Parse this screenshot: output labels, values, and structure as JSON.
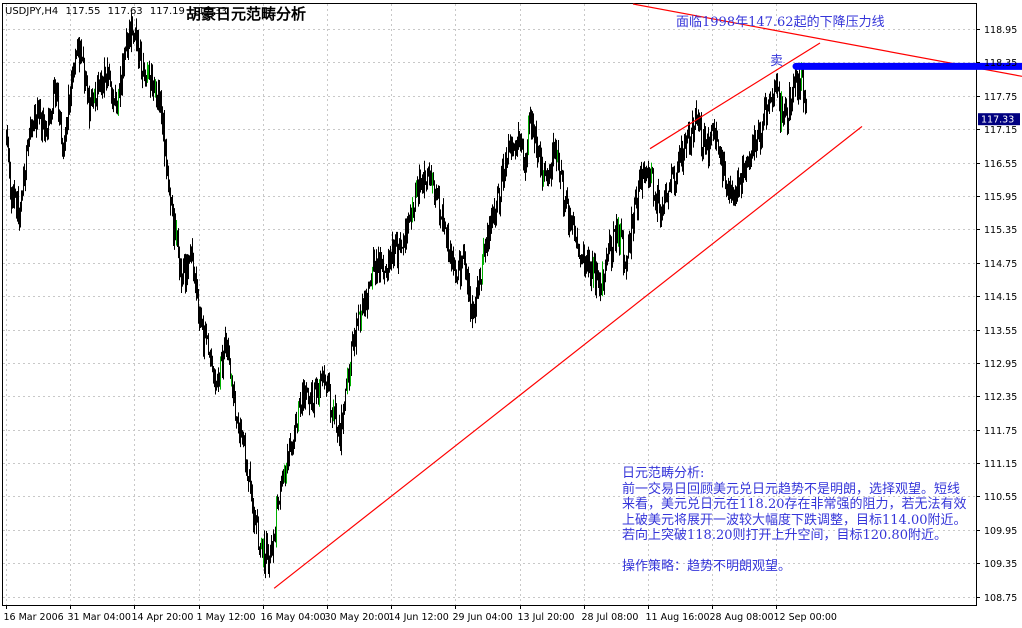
{
  "header": {
    "symbol": "USDJPY,H4",
    "open": "117.55",
    "high": "117.63",
    "low": "117.19",
    "close": "117.33",
    "title": "胡豪日元范畴分析"
  },
  "annotations": {
    "resistance_note": "面临1998年147.62起的下降压力线",
    "sell_note": "卖",
    "analysis_title": "日元范畴分析:",
    "analysis_body": "前一交易日回顾美元兑日元趋势不是明朗，选择观望。短线来看，美元兑日元在118.20存在非常强的阻力，若无法有效上破美元将展开一波较大幅度下跌调整，目标114.00附近。若向上突破118.20则打开上升空间，目标120.80附近。",
    "strategy": "操作策略：趋势不明朗观望。"
  },
  "colors": {
    "candle": "#000000",
    "up_tick": "#00b000",
    "trendline": "#ff0000",
    "resistance_bar": "#0000ff",
    "annotation_text": "#3535d9",
    "grid": "#c8c8c8",
    "price_marker_bg": "#000080"
  },
  "chart_data": {
    "type": "candlestick",
    "symbol": "USDJPY",
    "timeframe": "H4",
    "ylim": [
      108.6,
      119.4
    ],
    "y_ticks": [
      "118.95",
      "118.35",
      "117.75",
      "117.15",
      "116.55",
      "115.95",
      "115.35",
      "114.75",
      "114.15",
      "113.55",
      "112.95",
      "112.35",
      "111.75",
      "111.15",
      "110.55",
      "109.95",
      "109.35",
      "108.75"
    ],
    "x_ticks": [
      "16 Mar 2006",
      "31 Mar 04:00",
      "14 Apr 20:00",
      "1 May 12:00",
      "16 May 04:00",
      "30 May 20:00",
      "14 Jun 12:00",
      "29 Jun 04:00",
      "13 Jul 20:00",
      "28 Jul 08:00",
      "11 Aug 16:00",
      "28 Aug 08:00",
      "12 Sep 00:00"
    ],
    "current_price": "117.33",
    "path_points": [
      [
        "16 Mar 2006",
        117.0
      ],
      [
        "17 Mar 2006",
        116.0
      ],
      [
        "19 Mar 2006",
        115.6
      ],
      [
        "21 Mar 2006",
        116.9
      ],
      [
        "23 Mar 2006",
        117.5
      ],
      [
        "25 Mar 2006",
        117.1
      ],
      [
        "27 Mar 2006",
        117.9
      ],
      [
        "29 Mar 2006",
        116.8
      ],
      [
        "31 Mar 2006",
        118.1
      ],
      [
        "2 Apr 2006",
        118.6
      ],
      [
        "4 Apr 2006",
        117.5
      ],
      [
        "6 Apr 2006",
        117.9
      ],
      [
        "8 Apr 2006",
        118.3
      ],
      [
        "10 Apr 2006",
        117.6
      ],
      [
        "12 Apr 2006",
        118.6
      ],
      [
        "14 Apr 2006",
        118.9
      ],
      [
        "16 Apr 2006",
        118.2
      ],
      [
        "18 Apr 2006",
        118.1
      ],
      [
        "20 Apr 2006",
        117.6
      ],
      [
        "21 Apr 2006",
        116.9
      ],
      [
        "23 Apr 2006",
        115.4
      ],
      [
        "25 Apr 2006",
        114.4
      ],
      [
        "27 Apr 2006",
        114.9
      ],
      [
        "29 Apr 2006",
        113.7
      ],
      [
        "1 May 2006",
        113.1
      ],
      [
        "3 May 2006",
        112.5
      ],
      [
        "5 May 2006",
        113.5
      ],
      [
        "7 May 2006",
        112.2
      ],
      [
        "9 May 2006",
        111.4
      ],
      [
        "11 May 2006",
        110.4
      ],
      [
        "13 May 2006",
        109.6
      ],
      [
        "15 May 2006",
        109.4
      ],
      [
        "17 May 2006",
        110.4
      ],
      [
        "19 May 2006",
        111.3
      ],
      [
        "21 May 2006",
        111.8
      ],
      [
        "23 May 2006",
        112.5
      ],
      [
        "25 May 2006",
        112.3
      ],
      [
        "27 May 2006",
        112.8
      ],
      [
        "29 May 2006",
        112.2
      ],
      [
        "31 May 2006",
        111.7
      ],
      [
        "2 Jun 2006",
        112.9
      ],
      [
        "4 Jun 2006",
        113.6
      ],
      [
        "6 Jun 2006",
        114.2
      ],
      [
        "8 Jun 2006",
        114.8
      ],
      [
        "10 Jun 2006",
        114.5
      ],
      [
        "12 Jun 2006",
        115.0
      ],
      [
        "14 Jun 2006",
        114.9
      ],
      [
        "16 Jun 2006",
        115.6
      ],
      [
        "18 Jun 2006",
        116.1
      ],
      [
        "20 Jun 2006",
        116.3
      ],
      [
        "22 Jun 2006",
        116.0
      ],
      [
        "24 Jun 2006",
        115.2
      ],
      [
        "26 Jun 2006",
        114.6
      ],
      [
        "28 Jun 2006",
        114.8
      ],
      [
        "30 Jun 2006",
        113.9
      ],
      [
        "2 Jul 2006",
        114.6
      ],
      [
        "4 Jul 2006",
        115.4
      ],
      [
        "6 Jul 2006",
        115.9
      ],
      [
        "8 Jul 2006",
        116.8
      ],
      [
        "10 Jul 2006",
        117.0
      ],
      [
        "12 Jul 2006",
        116.4
      ],
      [
        "13 Jul 2006",
        117.5
      ],
      [
        "15 Jul 2006",
        116.7
      ],
      [
        "17 Jul 2006",
        116.2
      ],
      [
        "19 Jul 2006",
        116.9
      ],
      [
        "21 Jul 2006",
        115.8
      ],
      [
        "23 Jul 2006",
        115.3
      ],
      [
        "25 Jul 2006",
        114.9
      ],
      [
        "27 Jul 2006",
        114.6
      ],
      [
        "29 Jul 2006",
        114.4
      ],
      [
        "31 Jul 2006",
        114.9
      ],
      [
        "2 Aug 2006",
        115.3
      ],
      [
        "4 Aug 2006",
        114.8
      ],
      [
        "6 Aug 2006",
        115.7
      ],
      [
        "8 Aug 2006",
        116.5
      ],
      [
        "10 Aug 2006",
        116.2
      ],
      [
        "12 Aug 2006",
        115.5
      ],
      [
        "14 Aug 2006",
        116.1
      ],
      [
        "16 Aug 2006",
        116.6
      ],
      [
        "18 Aug 2006",
        116.9
      ],
      [
        "20 Aug 2006",
        117.3
      ],
      [
        "22 Aug 2006",
        116.7
      ],
      [
        "24 Aug 2006",
        117.2
      ],
      [
        "26 Aug 2006",
        116.4
      ],
      [
        "28 Aug 2006",
        115.8
      ],
      [
        "30 Aug 2006",
        116.2
      ],
      [
        "1 Sep 2006",
        116.5
      ],
      [
        "3 Sep 2006",
        117.0
      ],
      [
        "5 Sep 2006",
        117.5
      ],
      [
        "7 Sep 2006",
        117.8
      ],
      [
        "9 Sep 2006",
        117.3
      ],
      [
        "11 Sep 2006",
        117.9
      ],
      [
        "13 Sep 2006",
        118.1
      ],
      [
        "14 Sep 2006",
        117.33
      ]
    ]
  }
}
